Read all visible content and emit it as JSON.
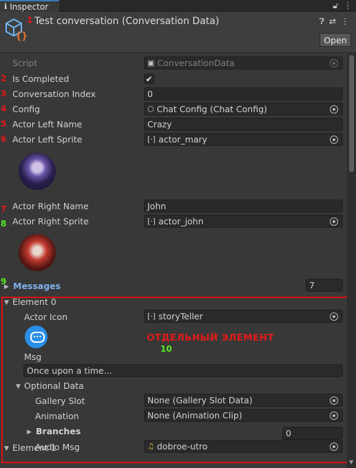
{
  "tab": {
    "icon": "info-icon",
    "label": "Inspector",
    "lock_icon": "lock-icon",
    "menu_icon": "kebab-menu-icon"
  },
  "header": {
    "title": "Test conversation (Conversation Data)",
    "open_label": "Open",
    "help_icon": "help-icon",
    "presets_icon": "presets-icon",
    "menu_icon": "kebab-menu-icon"
  },
  "annotations": {
    "n1": "1",
    "n2": "2",
    "n3": "3",
    "n4": "4",
    "n5": "5",
    "n6": "6",
    "n7": "7",
    "n8": "8",
    "n9": "9",
    "n10": "10",
    "separate_element": "ОТДЕЛЬНЫЙ ЭЛЕМЕНТ"
  },
  "fields": {
    "script_label": "Script",
    "script_value": "ConversationData",
    "is_completed_label": "Is Completed",
    "is_completed_checked": true,
    "conversation_index_label": "Conversation Index",
    "conversation_index_value": "0",
    "config_label": "Config",
    "config_value": "Chat Config (Chat Config)",
    "actor_left_name_label": "Actor Left Name",
    "actor_left_name_value": "Crazy",
    "actor_left_sprite_label": "Actor Left Sprite",
    "actor_left_sprite_value": "actor_mary",
    "actor_right_name_label": "Actor Right Name",
    "actor_right_name_value": "John",
    "actor_right_sprite_label": "Actor Right Sprite",
    "actor_right_sprite_value": "actor_john"
  },
  "messages": {
    "label": "Messages",
    "count": "7",
    "element0": {
      "label": "Element 0",
      "actor_icon_label": "Actor Icon",
      "actor_icon_value": "storyTeller",
      "msg_label": "Msg",
      "msg_value": "Once upon a time...",
      "optional_data_label": "Optional Data",
      "gallery_slot_label": "Gallery Slot",
      "gallery_slot_value": "None (Gallery Slot Data)",
      "animation_label": "Animation",
      "animation_value": "None (Animation Clip)",
      "branches_label": "Branches",
      "branches_count": "0",
      "audio_msg_label": "Audio Msg",
      "audio_msg_value": "dobroe-utro"
    },
    "element1": {
      "label": "Element 1"
    }
  },
  "colors": {
    "accent": "#7eb3ef",
    "annotation_red": "#e01818",
    "annotation_green": "#55ee22",
    "chat_icon": "#2a8fe6"
  }
}
